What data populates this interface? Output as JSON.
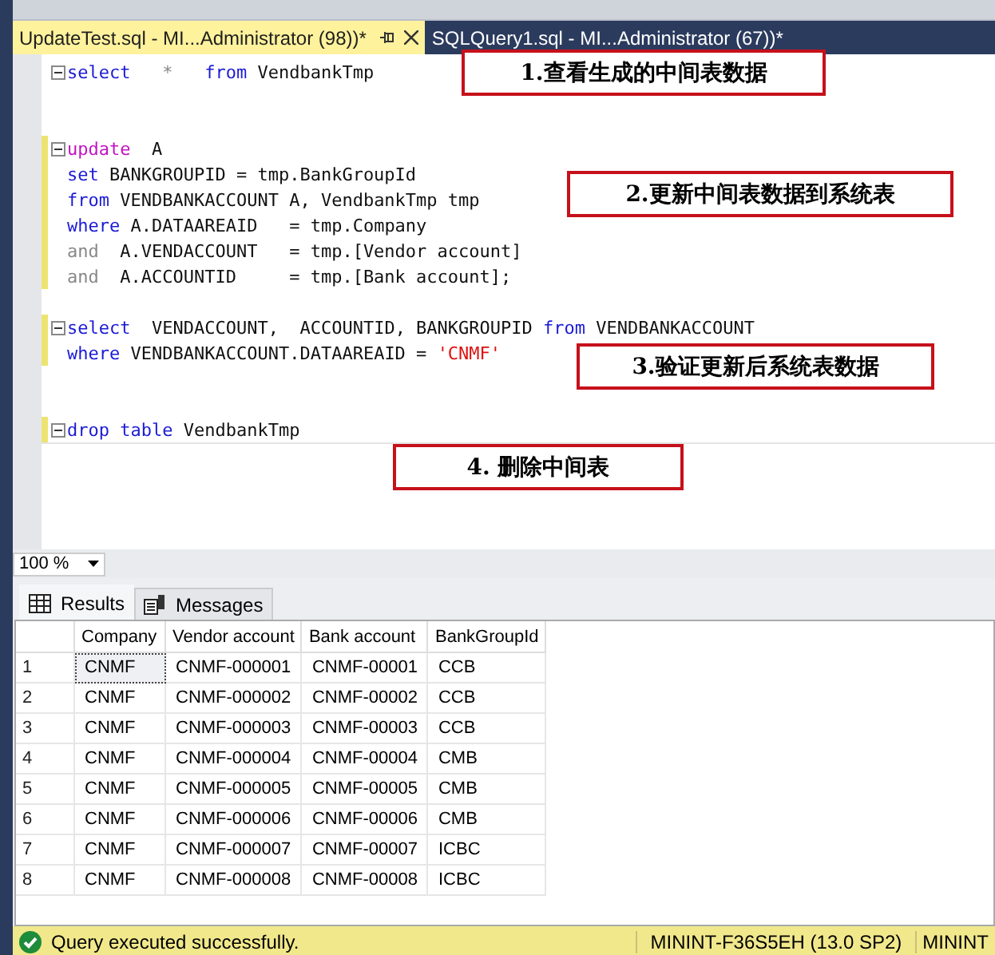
{
  "tabs": [
    {
      "label": "UpdateTest.sql - MI...Administrator (98))*",
      "selected": true
    },
    {
      "label": "SQLQuery1.sql - MI...Administrator (67))*",
      "selected": false
    }
  ],
  "editor": {
    "blocks": [
      {
        "modified": false,
        "lines": [
          [
            {
              "kind": "keyword",
              "text": "select"
            },
            {
              "kind": "gray",
              "text": "   *   "
            },
            {
              "kind": "keyword",
              "text": "from"
            },
            {
              "kind": "plain",
              "text": " VendbankTmp"
            }
          ]
        ]
      },
      {
        "modified": true,
        "lines": [
          [
            {
              "kind": "function",
              "text": "update"
            },
            {
              "kind": "plain",
              "text": "  A"
            }
          ],
          [
            {
              "kind": "keyword",
              "text": "set"
            },
            {
              "kind": "plain",
              "text": " BANKGROUPID = tmp.BankGroupId"
            }
          ],
          [
            {
              "kind": "keyword",
              "text": "from"
            },
            {
              "kind": "plain",
              "text": " VENDBANKACCOUNT A, VendbankTmp tmp"
            }
          ],
          [
            {
              "kind": "keyword",
              "text": "where"
            },
            {
              "kind": "plain",
              "text": " A.DATAAREAID   = tmp.Company"
            }
          ],
          [
            {
              "kind": "gray",
              "text": "and"
            },
            {
              "kind": "plain",
              "text": "  A.VENDACCOUNT   = tmp.[Vendor account]"
            }
          ],
          [
            {
              "kind": "gray",
              "text": "and"
            },
            {
              "kind": "plain",
              "text": "  A.ACCOUNTID     = tmp.[Bank account];"
            }
          ]
        ]
      },
      {
        "modified": true,
        "lines": [
          [
            {
              "kind": "keyword",
              "text": "select"
            },
            {
              "kind": "plain",
              "text": "  VENDACCOUNT,  ACCOUNTID, BANKGROUPID "
            },
            {
              "kind": "keyword",
              "text": "from"
            },
            {
              "kind": "plain",
              "text": " VENDBANKACCOUNT"
            }
          ],
          [
            {
              "kind": "keyword",
              "text": "where"
            },
            {
              "kind": "plain",
              "text": " VENDBANKACCOUNT.DATAAREAID = "
            },
            {
              "kind": "string",
              "text": "'CNMF'"
            }
          ]
        ]
      },
      {
        "modified": true,
        "lines": [
          [
            {
              "kind": "keyword",
              "text": "drop table"
            },
            {
              "kind": "plain",
              "text": " VendbankTmp"
            }
          ]
        ]
      }
    ],
    "notes": [
      "1.查看生成的中间表数据",
      "2.更新中间表数据到系统表",
      "3.验证更新后系统表数据",
      "4. 删除中间表"
    ]
  },
  "zoom": "100 %",
  "result_tabs": [
    {
      "label": "Results",
      "selected": true
    },
    {
      "label": "Messages",
      "selected": false
    }
  ],
  "grid": {
    "columns": [
      "Company",
      "Vendor account",
      "Bank account",
      "BankGroupId"
    ],
    "rows": [
      {
        "number": "1",
        "cells": [
          "CNMF",
          "CNMF-000001",
          "CNMF-00001",
          "CCB"
        ],
        "selected": true
      },
      {
        "number": "2",
        "cells": [
          "CNMF",
          "CNMF-000002",
          "CNMF-00002",
          "CCB"
        ],
        "selected": false
      },
      {
        "number": "3",
        "cells": [
          "CNMF",
          "CNMF-000003",
          "CNMF-00003",
          "CCB"
        ],
        "selected": false
      },
      {
        "number": "4",
        "cells": [
          "CNMF",
          "CNMF-000004",
          "CNMF-00004",
          "CMB"
        ],
        "selected": false
      },
      {
        "number": "5",
        "cells": [
          "CNMF",
          "CNMF-000005",
          "CNMF-00005",
          "CMB"
        ],
        "selected": false
      },
      {
        "number": "6",
        "cells": [
          "CNMF",
          "CNMF-000006",
          "CNMF-00006",
          "CMB"
        ],
        "selected": false
      },
      {
        "number": "7",
        "cells": [
          "CNMF",
          "CNMF-000007",
          "CNMF-00007",
          "ICBC"
        ],
        "selected": false
      },
      {
        "number": "8",
        "cells": [
          "CNMF",
          "CNMF-000008",
          "CNMF-00008",
          "ICBC"
        ],
        "selected": false
      }
    ]
  },
  "status_bar": {
    "message": "Query executed successfully.",
    "server": "MININT-F36S5EH (13.0 SP2)",
    "user": "MININT"
  }
}
